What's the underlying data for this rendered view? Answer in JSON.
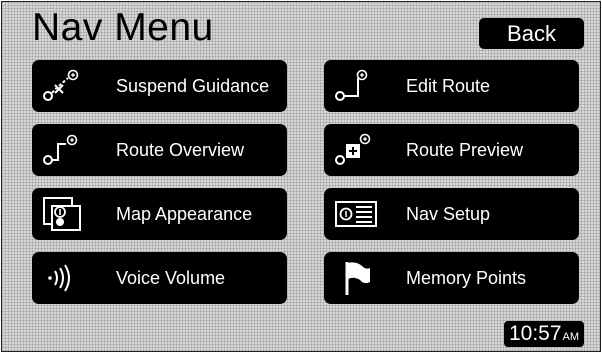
{
  "header": {
    "title": "Nav Menu",
    "back_label": "Back"
  },
  "menu": {
    "items": [
      {
        "label": "Suspend Guidance",
        "icon": "suspend-guidance-icon"
      },
      {
        "label": "Edit Route",
        "icon": "edit-route-icon"
      },
      {
        "label": "Route Overview",
        "icon": "route-overview-icon"
      },
      {
        "label": "Route Preview",
        "icon": "route-preview-icon"
      },
      {
        "label": "Map Appearance",
        "icon": "map-appearance-icon"
      },
      {
        "label": "Nav Setup",
        "icon": "nav-setup-icon"
      },
      {
        "label": "Voice Volume",
        "icon": "voice-volume-icon"
      },
      {
        "label": "Memory Points",
        "icon": "memory-points-icon"
      }
    ]
  },
  "status": {
    "time": "10:57",
    "ampm": "AM"
  },
  "colors": {
    "button_bg": "#000000",
    "button_text": "#ffffff",
    "screen_bg": "#d6d6d6"
  }
}
